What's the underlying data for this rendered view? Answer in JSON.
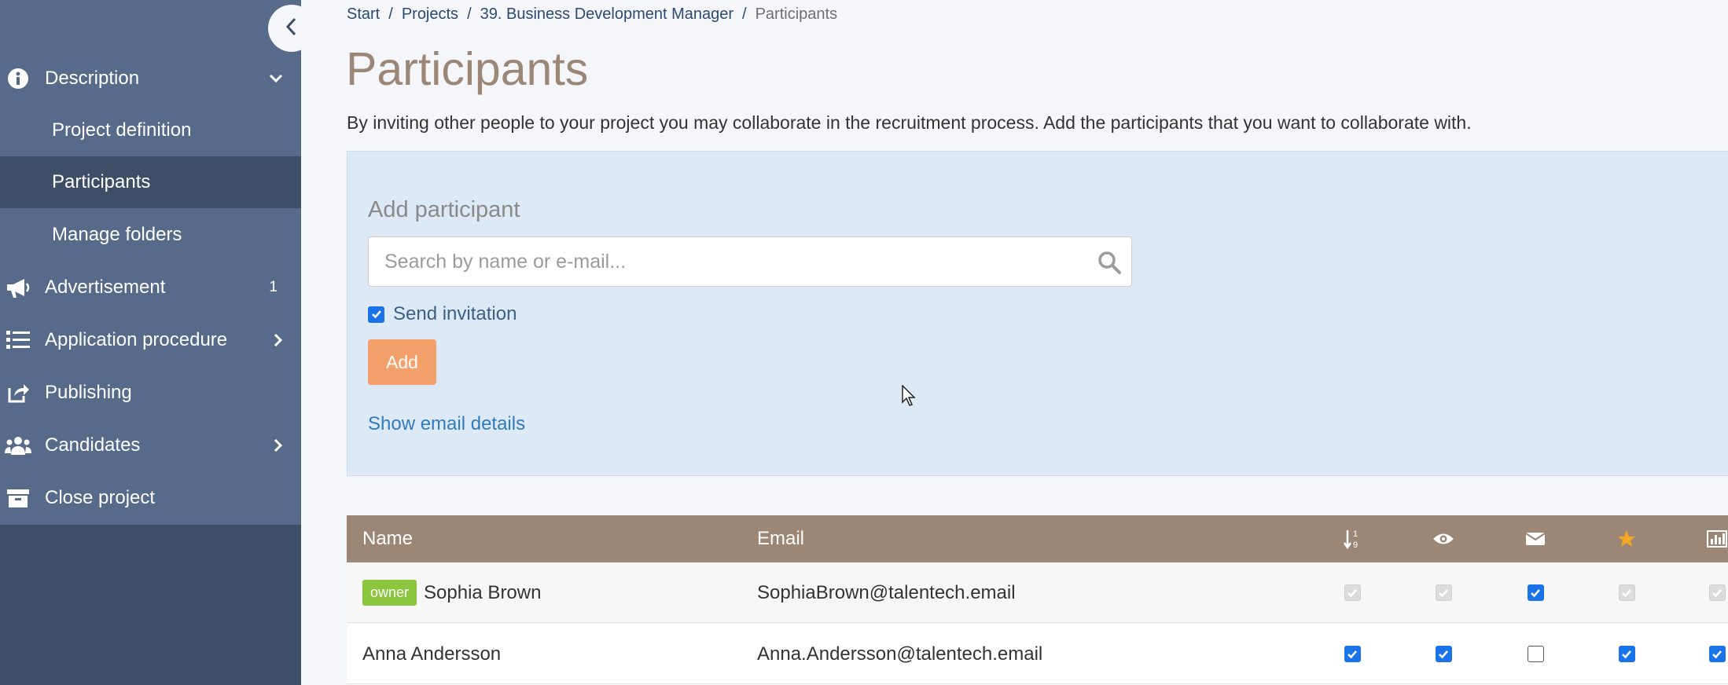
{
  "sidebar": {
    "items": [
      {
        "label": "Description",
        "icon": "info-icon"
      },
      {
        "label": "Project definition"
      },
      {
        "label": "Participants"
      },
      {
        "label": "Manage folders"
      },
      {
        "label": "Advertisement",
        "badge": "1",
        "icon": "megaphone-icon"
      },
      {
        "label": "Application procedure",
        "icon": "list-icon"
      },
      {
        "label": "Publishing",
        "icon": "share-icon"
      },
      {
        "label": "Candidates",
        "icon": "users-icon"
      },
      {
        "label": "Close project",
        "icon": "archive-icon"
      }
    ]
  },
  "breadcrumb": [
    "Start",
    "Projects",
    "39. Business Development Manager",
    "Participants"
  ],
  "page": {
    "title": "Participants",
    "intro": "By inviting other people to your project you may collaborate in the recruitment process. Add the participants that you want to collaborate with."
  },
  "add_panel": {
    "title": "Add participant",
    "search_placeholder": "Search by name or e-mail...",
    "send_invitation_label": "Send invitation",
    "send_invitation_checked": true,
    "add_button": "Add",
    "email_details_link": "Show email details"
  },
  "table": {
    "headers": {
      "name": "Name",
      "email": "Email"
    },
    "icon_columns": [
      "sort-order-icon",
      "eye-icon",
      "envelope-icon",
      "star-icon",
      "bar-chart-icon"
    ],
    "rows": [
      {
        "badge": "owner",
        "name": "Sophia Brown",
        "email": "SophiaBrown@talentech.email",
        "flags": [
          "disabled-checked",
          "disabled-checked",
          "checked",
          "disabled-checked",
          "disabled-checked"
        ]
      },
      {
        "badge": "",
        "name": "Anna Andersson",
        "email": "Anna.Andersson@talentech.email",
        "flags": [
          "checked",
          "checked",
          "unchecked",
          "checked",
          "checked"
        ]
      }
    ]
  },
  "colors": {
    "sidebar_dark": "#3e4e66",
    "sidebar_light": "#576a89",
    "title_brown": "#9c8777",
    "panel_blue": "#dde9f5",
    "add_orange": "#f4a06a",
    "owner_green": "#8cc63f",
    "star_orange": "#f5a623"
  }
}
